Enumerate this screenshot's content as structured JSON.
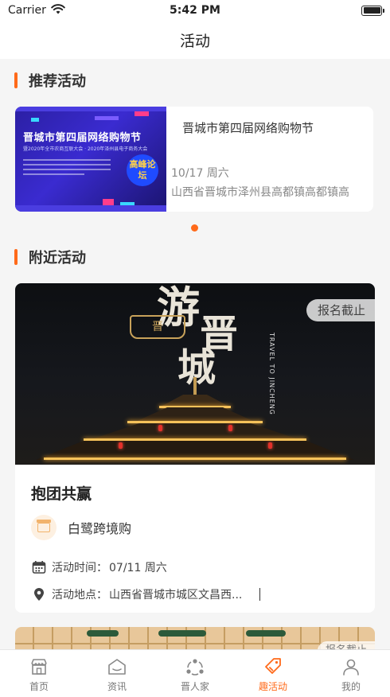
{
  "status_bar": {
    "carrier": "Carrier",
    "time": "5:42 PM"
  },
  "nav": {
    "title": "活动"
  },
  "recommended": {
    "section_title": "推荐活动",
    "card": {
      "name": "晋城市第四届网络购物节",
      "date": "10/17 周六",
      "address": "山西省晋城市泽州县高都镇高都镇高",
      "banner_title": "晋城市第四届网络购物节",
      "banner_subtitle": "暨2020年全市农商互联大会 · 2020年泽州县电子商务大会",
      "banner_badge": "高峰论坛"
    }
  },
  "nearby": {
    "section_title": "附近活动",
    "card": {
      "status_tag": "报名截止",
      "name": "抱团共赢",
      "organizer": "白鹭跨境购",
      "time_label": "活动时间：",
      "time_value": "07/11 周六",
      "place_label": "活动地点：",
      "place_value": "山西省晋城市城区文昌西...",
      "image_calligraphy_1": "游",
      "image_calligraphy_2": "晋",
      "image_calligraphy_3": "城",
      "image_logo": "晋",
      "image_vertical_text": "TRAVEL TO JINCHENG"
    },
    "next_card_tag": "报名截止"
  },
  "tab_bar": {
    "tabs": [
      {
        "label": "首页",
        "icon": "home-store-icon"
      },
      {
        "label": "资讯",
        "icon": "news-icon"
      },
      {
        "label": "晋人家",
        "icon": "community-icon"
      },
      {
        "label": "趣活动",
        "icon": "activity-tag-icon"
      },
      {
        "label": "我的",
        "icon": "profile-icon"
      }
    ],
    "active_index": 3
  },
  "colors": {
    "accent": "#ff6a1a",
    "background": "#f5f5f5",
    "card": "#ffffff",
    "text_muted": "#888888"
  }
}
